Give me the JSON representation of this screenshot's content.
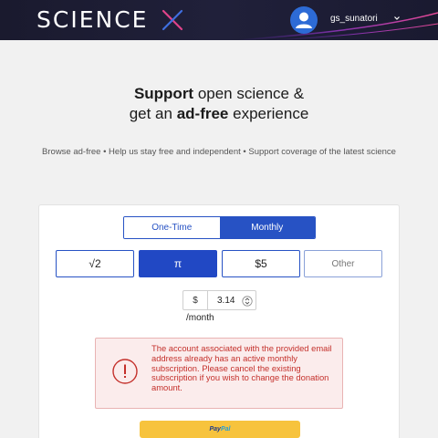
{
  "header": {
    "logo_text": "SCIENCE",
    "logo_mark": "X",
    "username": "gs_sunatori",
    "avatar_icon": "user-avatar-icon",
    "chevron_icon": "chevron-down-icon",
    "colors": {
      "accent": "#2752c4",
      "logo_mark": "#e0438a"
    }
  },
  "hero": {
    "title_bold_1": "Support",
    "title_rest_1": " open science &",
    "title_rest_2a": "get an ",
    "title_bold_2": "ad-free",
    "title_rest_2b": " experience",
    "subtitle": "Browse ad-free • Help us stay free and independent • Support coverage of the latest science"
  },
  "donation": {
    "frequency": {
      "one_time": "One-Time",
      "monthly": "Monthly",
      "selected": "Monthly"
    },
    "amounts": [
      {
        "label": "√2",
        "selected": false
      },
      {
        "label": "π",
        "selected": true
      },
      {
        "label": "$5",
        "selected": false
      },
      {
        "label": "Other",
        "selected": false
      }
    ],
    "custom": {
      "currency": "$",
      "value": "3.14",
      "period": "/month"
    },
    "alert": {
      "icon": "alert-circle-icon",
      "message": "The account associated with the provided email address already has an active monthly subscription. Please cancel the existing subscription if you wish to change the donation amount."
    },
    "paypal": {
      "part1": "Pay",
      "part2": "Pal"
    }
  }
}
